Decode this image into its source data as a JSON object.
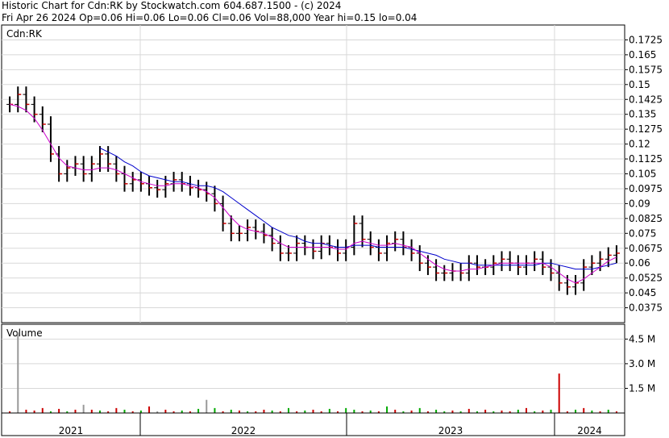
{
  "header": {
    "line1": "Historic Chart for Cdn:RK by Stockwatch.com 604.687.1500 - (c) 2024",
    "line2": "Fri Apr 26 2024   Op=0.06  Hi=0.06  Lo=0.06  Cl=0.06  Vol=88,000  Year hi=0.15  lo=0.04"
  },
  "chart_data": [
    {
      "type": "line",
      "title": "Cdn:RK",
      "ylim": [
        0.03,
        0.18
      ],
      "y_ticks": [
        "0.1725",
        "0.165",
        "0.1575",
        "0.15",
        "0.1425",
        "0.135",
        "0.1275",
        "0.12",
        "0.1125",
        "0.105",
        "0.0975",
        "0.09",
        "0.0825",
        "0.075",
        "0.0675",
        "0.06",
        "0.0525",
        "0.045",
        "0.0375"
      ],
      "x_labels": [
        "2021",
        "2022",
        "2023",
        "2024"
      ],
      "price_colors": {
        "bar": "#000000",
        "close_tick": "#cc0000",
        "ma_short": "#cc00cc",
        "ma_long": "#0000cc"
      },
      "series": [
        {
          "values": [
            0.14,
            0.145,
            0.14,
            0.135,
            0.13,
            0.115,
            0.105,
            0.108,
            0.11,
            0.105,
            0.11,
            0.115,
            0.11,
            0.105,
            0.1,
            0.102,
            0.1,
            0.098,
            0.097,
            0.1,
            0.102,
            0.1,
            0.098,
            0.097,
            0.095,
            0.09,
            0.08,
            0.075,
            0.075,
            0.078,
            0.076,
            0.074,
            0.07,
            0.065,
            0.065,
            0.07,
            0.068,
            0.066,
            0.07,
            0.068,
            0.065,
            0.068,
            0.08,
            0.072,
            0.068,
            0.065,
            0.07,
            0.072,
            0.068,
            0.065,
            0.06,
            0.058,
            0.055,
            0.055,
            0.056,
            0.055,
            0.06,
            0.058,
            0.058,
            0.06,
            0.062,
            0.06,
            0.058,
            0.06,
            0.062,
            0.058,
            0.055,
            0.05,
            0.048,
            0.05,
            0.058,
            0.06,
            0.062,
            0.064,
            0.065
          ]
        }
      ],
      "ma_short": [
        0.14,
        0.139,
        0.137,
        0.133,
        0.127,
        0.12,
        0.113,
        0.109,
        0.108,
        0.107,
        0.107,
        0.108,
        0.108,
        0.107,
        0.105,
        0.103,
        0.101,
        0.1,
        0.099,
        0.099,
        0.1,
        0.1,
        0.099,
        0.098,
        0.096,
        0.093,
        0.088,
        0.083,
        0.079,
        0.077,
        0.076,
        0.075,
        0.073,
        0.07,
        0.068,
        0.068,
        0.068,
        0.068,
        0.068,
        0.068,
        0.067,
        0.067,
        0.07,
        0.071,
        0.07,
        0.069,
        0.069,
        0.07,
        0.069,
        0.068,
        0.065,
        0.062,
        0.059,
        0.057,
        0.056,
        0.056,
        0.057,
        0.057,
        0.058,
        0.059,
        0.06,
        0.06,
        0.06,
        0.06,
        0.06,
        0.06,
        0.058,
        0.055,
        0.052,
        0.05,
        0.052,
        0.055,
        0.058,
        0.061,
        0.063
      ],
      "ma_long": [
        null,
        null,
        null,
        null,
        null,
        null,
        null,
        null,
        null,
        null,
        null,
        0.118,
        0.116,
        0.114,
        0.111,
        0.109,
        0.106,
        0.104,
        0.103,
        0.102,
        0.101,
        0.101,
        0.1,
        0.099,
        0.099,
        0.098,
        0.096,
        0.093,
        0.09,
        0.087,
        0.084,
        0.081,
        0.078,
        0.076,
        0.074,
        0.073,
        0.071,
        0.07,
        0.07,
        0.069,
        0.068,
        0.068,
        0.069,
        0.069,
        0.069,
        0.068,
        0.068,
        0.068,
        0.068,
        0.067,
        0.066,
        0.065,
        0.064,
        0.062,
        0.061,
        0.06,
        0.06,
        0.059,
        0.059,
        0.059,
        0.059,
        0.059,
        0.059,
        0.059,
        0.059,
        0.06,
        0.06,
        0.059,
        0.058,
        0.057,
        0.057,
        0.057,
        0.058,
        0.059,
        0.06
      ]
    },
    {
      "type": "bar",
      "title": "Volume",
      "y_ticks": [
        "4.5 M",
        "3.0 M",
        "1.5 M"
      ],
      "ylim": [
        0,
        5.4
      ],
      "colors": {
        "up": "#00aa00",
        "down": "#cc0000",
        "flat": "#999999"
      },
      "values": [
        0.1,
        4.9,
        0.2,
        0.15,
        0.3,
        0.1,
        0.25,
        0.1,
        0.2,
        0.5,
        0.2,
        0.15,
        0.1,
        0.3,
        0.2,
        0.1,
        0.15,
        0.4,
        0.1,
        0.2,
        0.1,
        0.15,
        0.1,
        0.25,
        0.8,
        0.3,
        0.1,
        0.2,
        0.15,
        0.1,
        0.1,
        0.2,
        0.15,
        0.1,
        0.3,
        0.1,
        0.15,
        0.2,
        0.1,
        0.25,
        0.1,
        0.3,
        0.2,
        0.1,
        0.15,
        0.1,
        0.4,
        0.2,
        0.1,
        0.15,
        0.3,
        0.1,
        0.2,
        0.1,
        0.15,
        0.1,
        0.25,
        0.1,
        0.2,
        0.1,
        0.15,
        0.1,
        0.2,
        0.3,
        0.1,
        0.15,
        0.2,
        2.4,
        0.1,
        0.2,
        0.3,
        0.15,
        0.1,
        0.2,
        0.1
      ],
      "kinds": [
        "d",
        "f",
        "d",
        "d",
        "d",
        "u",
        "d",
        "u",
        "d",
        "f",
        "d",
        "u",
        "d",
        "d",
        "u",
        "d",
        "u",
        "d",
        "f",
        "d",
        "d",
        "u",
        "d",
        "u",
        "f",
        "u",
        "d",
        "u",
        "d",
        "u",
        "d",
        "d",
        "u",
        "d",
        "u",
        "d",
        "u",
        "d",
        "d",
        "u",
        "d",
        "u",
        "u",
        "d",
        "u",
        "d",
        "u",
        "d",
        "u",
        "d",
        "u",
        "d",
        "u",
        "u",
        "d",
        "u",
        "d",
        "u",
        "d",
        "u",
        "d",
        "d",
        "u",
        "d",
        "u",
        "d",
        "u",
        "d",
        "d",
        "u",
        "d",
        "u",
        "d",
        "u",
        "d"
      ]
    }
  ],
  "year_labels": [
    "2021",
    "2022",
    "2023",
    "2024"
  ]
}
